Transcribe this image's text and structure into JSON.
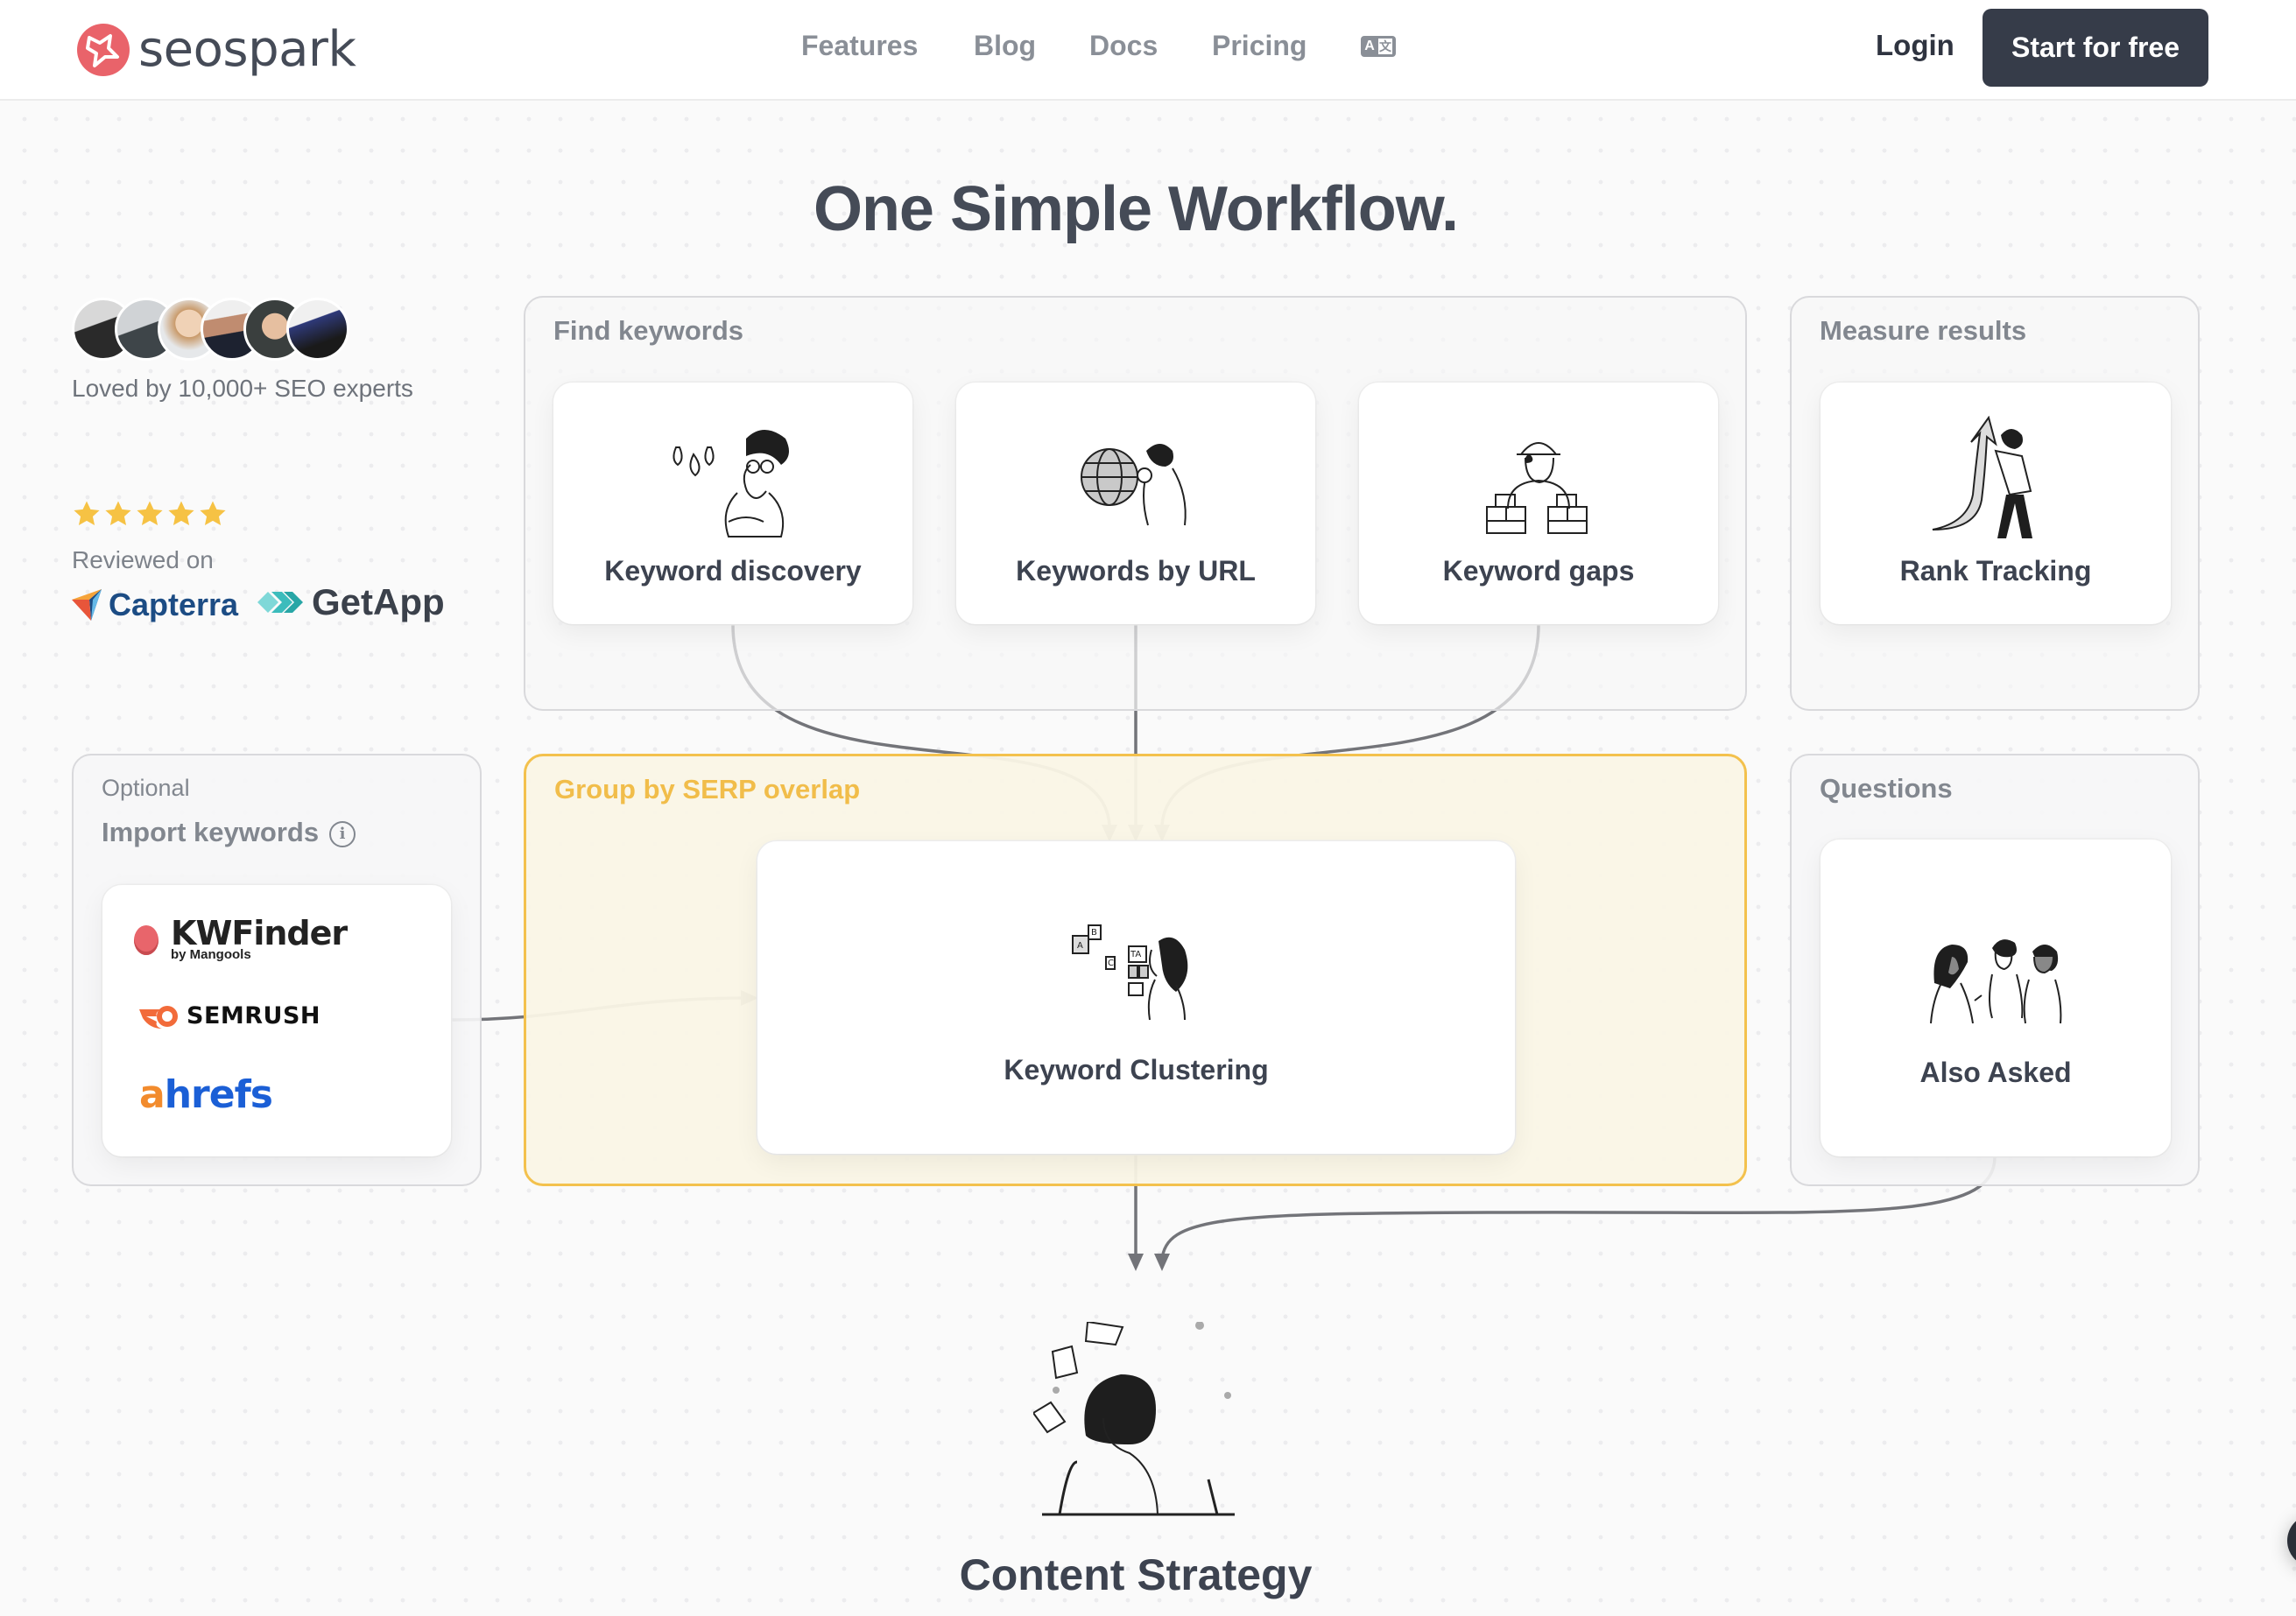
{
  "header": {
    "brand": "seospark",
    "nav": [
      {
        "label": "Features"
      },
      {
        "label": "Blog"
      },
      {
        "label": "Docs"
      },
      {
        "label": "Pricing"
      }
    ],
    "language_icon": {
      "left": "A",
      "right": "文"
    },
    "login_label": "Login",
    "cta_label": "Start for free"
  },
  "page_title": "One Simple Workflow.",
  "social_proof": {
    "avatar_count": 6,
    "loved_text": "Loved by 10,000+ SEO experts",
    "rating_stars": 5,
    "reviewed_on": "Reviewed on",
    "review_sites": [
      "Capterra",
      "GetApp"
    ]
  },
  "workflow": {
    "find_keywords": {
      "title": "Find keywords",
      "cards": [
        {
          "label": "Keyword discovery",
          "icon": "ideas-illustration"
        },
        {
          "label": "Keywords by URL",
          "icon": "globe-search-illustration"
        },
        {
          "label": "Keyword gaps",
          "icon": "builder-illustration"
        }
      ]
    },
    "measure_results": {
      "title": "Measure results",
      "card": {
        "label": "Rank Tracking",
        "icon": "rising-arrow-illustration"
      }
    },
    "import": {
      "optional_label": "Optional",
      "title": "Import keywords",
      "tools": [
        {
          "name": "KWFinder",
          "sub": "by Mangools"
        },
        {
          "name": "SEMRUSH"
        },
        {
          "name_a": "a",
          "name_rest": "hrefs"
        }
      ]
    },
    "group": {
      "title": "Group by SERP overlap",
      "card": {
        "label": "Keyword Clustering",
        "icon": "letter-blocks-illustration"
      }
    },
    "questions": {
      "title": "Questions",
      "card": {
        "label": "Also Asked",
        "icon": "people-talking-illustration"
      }
    },
    "output": {
      "label": "Content Strategy",
      "icon": "writer-illustration"
    }
  },
  "colors": {
    "brand": "#e9636a",
    "cta_bg": "#363c49",
    "group_accent": "#f3c14d",
    "star": "#f6c244",
    "connector": "#737479"
  }
}
